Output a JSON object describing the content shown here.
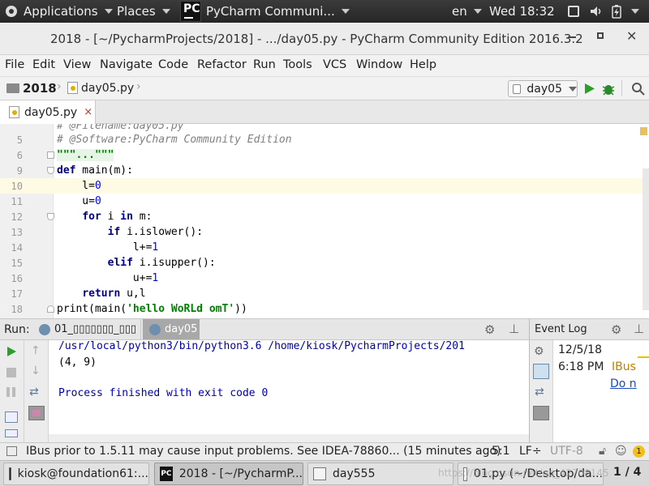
{
  "topbar": {
    "applications": "Applications",
    "places": "Places",
    "app_name": "PyCharm Communi...",
    "lang": "en",
    "clock": "Wed 18:32"
  },
  "window": {
    "title": "2018 - [~/PycharmProjects/2018] - .../day05.py - PyCharm Community Edition 2016.3.2"
  },
  "menu": [
    "File",
    "Edit",
    "View",
    "Navigate",
    "Code",
    "Refactor",
    "Run",
    "Tools",
    "VCS",
    "Window",
    "Help"
  ],
  "nav": {
    "project": "2018",
    "file": "day05.py",
    "run_config": "day05"
  },
  "editor_tab": {
    "label": "day05.py",
    "close": "×"
  },
  "editor": {
    "lines": [
      {
        "n": "",
        "text": "# @Filename:day05.py"
      },
      {
        "n": "5",
        "text": "# @Software:PyCharm Community Edition"
      },
      {
        "n": "6",
        "text": "\"\"\"...\"\"\""
      },
      {
        "n": "9",
        "text": "def main(m):"
      },
      {
        "n": "10",
        "text": "    l=0"
      },
      {
        "n": "11",
        "text": "    u=0"
      },
      {
        "n": "12",
        "text": "    for i in m:"
      },
      {
        "n": "13",
        "text": "        if i.islower():"
      },
      {
        "n": "14",
        "text": "            l+=1"
      },
      {
        "n": "15",
        "text": "        elif i.isupper():"
      },
      {
        "n": "16",
        "text": "            u+=1"
      },
      {
        "n": "17",
        "text": "    return u,l"
      },
      {
        "n": "18",
        "text": "print(main('hello WoRLd omT'))"
      }
    ]
  },
  "run_panel": {
    "label": "Run:",
    "tab1": "01_▯▯▯▯▯▯▯_▯▯▯",
    "tab2": "day05",
    "output": [
      "/usr/local/python3/bin/python3.6 /home/kiosk/PycharmProjects/201",
      "(4, 9)",
      "",
      "Process finished with exit code 0"
    ]
  },
  "event_log": {
    "title": "Event Log",
    "date": "12/5/18",
    "time": "6:18 PM",
    "source": "IBus",
    "link": "Do n"
  },
  "statusbar": {
    "message": "IBus prior to 1.5.11 may cause input problems. See IDEA-78860... (15 minutes ago)",
    "position": "5:1",
    "line_sep": "LF÷",
    "encoding": "UTF-8",
    "notifications": "1"
  },
  "taskbar": {
    "items": [
      "kiosk@foundation61:...",
      "2018 - [~/PycharmP...",
      "day555",
      "01.py (~/Desktop/da..."
    ],
    "pager": "1 / 4",
    "watermark": "https://blog.csdn.net/qq_42708145"
  },
  "colors": {
    "accent_run": "#2aa02a",
    "current_line": "#fffae3",
    "keyword": "#000080",
    "string": "#008000",
    "number": "#0000ff"
  }
}
